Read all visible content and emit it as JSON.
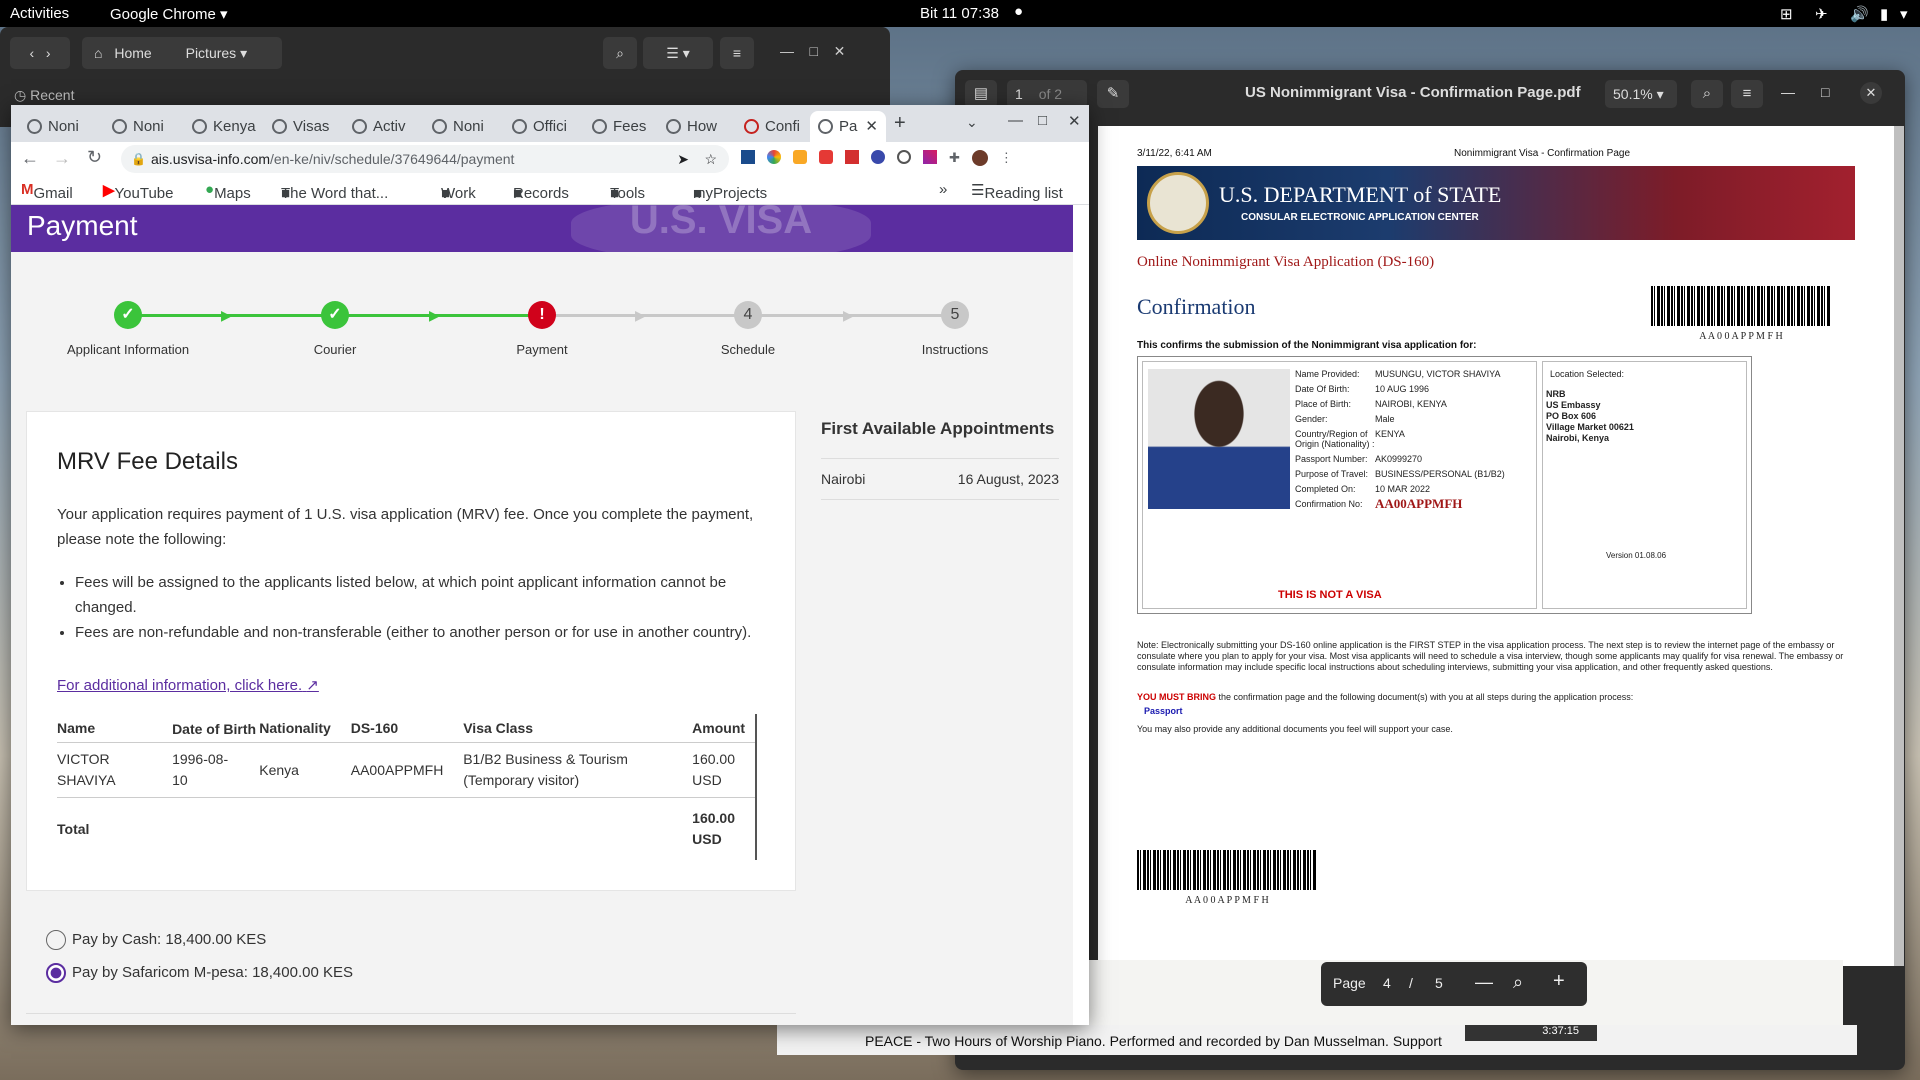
{
  "system_bar": {
    "activities": "Activities",
    "app": "Google Chrome",
    "clock": "Bit 11  07:38"
  },
  "file_manager": {
    "home": "Home",
    "pictures": "Pictures",
    "recent": "Recent"
  },
  "chrome": {
    "tabs": [
      "Noni",
      "Noni",
      "Kenya",
      "Visas",
      "Activ",
      "Noni",
      "Offici",
      "Fees",
      "How",
      "Confi",
      "Pa"
    ],
    "url_host": "ais.usvisa-info.com",
    "url_path": "/en-ke/niv/schedule/37649644/payment",
    "bookmarks": [
      "Gmail",
      "YouTube",
      "Maps",
      "The Word that...",
      "Work",
      "Records",
      "Tools",
      "myProjects"
    ],
    "reading_list": "Reading list"
  },
  "page": {
    "banner_title": "Payment",
    "steps": [
      {
        "label": "Applicant Information",
        "mark": "✓"
      },
      {
        "label": "Courier",
        "mark": "✓"
      },
      {
        "label": "Payment",
        "mark": "!"
      },
      {
        "label": "Schedule",
        "mark": "4"
      },
      {
        "label": "Instructions",
        "mark": "5"
      }
    ],
    "card": {
      "title": "MRV Fee Details",
      "intro": "Your application requires payment of 1 U.S. visa application (MRV) fee. Once you complete the payment, please note the following:",
      "bullet1": "Fees will be assigned to the applicants listed below, at which point applicant information cannot be changed.",
      "bullet2": "Fees are non-refundable and non-transferable (either to another person or for use in another country).",
      "link": "For additional information, click here.",
      "headers": {
        "name": "Name",
        "dob": "Date of Birth",
        "nationality": "Nationality",
        "ds160": "DS-160",
        "visa_class": "Visa Class",
        "amount": "Amount"
      },
      "row": {
        "name": "VICTOR SHAVIYA",
        "dob": "1996-08-10",
        "nationality": "Kenya",
        "ds160": "AA00APPMFH",
        "visa_class": "B1/B2 Business & Tourism (Temporary visitor)",
        "amount": "160.00 USD"
      },
      "total_label": "Total",
      "total_amount": "160.00 USD"
    },
    "side": {
      "title": "First Available Appointments",
      "city": "Nairobi",
      "date": "16 August, 2023"
    },
    "payment_options": [
      "Pay by Cash: 18,400.00 KES",
      "Pay by Safaricom M-pesa: 18,400.00 KES"
    ]
  },
  "pdf_viewer": {
    "page_box": "1",
    "page_of": "of 2",
    "title": "US Nonimmigrant Visa - Confirmation Page.pdf",
    "zoom": "50.1%",
    "doc": {
      "timestamp": "3/11/22, 6:41 AM",
      "header_title": "Nonimmigrant Visa - Confirmation Page",
      "dept": "U.S. DEPARTMENT of STATE",
      "ceac": "CONSULAR ELECTRONIC APPLICATION CENTER",
      "app_title": "Online Nonimmigrant Visa Application (DS-160)",
      "confirmation": "Confirmation",
      "barcode_text": "A A 0 0 A P P M F H",
      "confirms": "This confirms the submission of the Nonimmigrant visa application for:",
      "fields": [
        {
          "k": "Name Provided:",
          "v": "MUSUNGU, VICTOR SHAVIYA"
        },
        {
          "k": "Date Of Birth:",
          "v": "10 AUG 1996"
        },
        {
          "k": "Place of Birth:",
          "v": "NAIROBI, KENYA"
        },
        {
          "k": "Gender:",
          "v": "Male"
        },
        {
          "k": "Country/Region of Origin (Nationality) :",
          "v": "KENYA"
        },
        {
          "k": "Passport Number:",
          "v": "AK0999270"
        },
        {
          "k": "Purpose of Travel:",
          "v": "BUSINESS/PERSONAL (B1/B2)"
        },
        {
          "k": "Completed On:",
          "v": "10 MAR 2022"
        },
        {
          "k": "Confirmation No:",
          "v": "AA00APPMFH"
        }
      ],
      "not_visa": "THIS IS NOT A VISA",
      "location_label": "Location Selected:",
      "location": [
        "NRB",
        "US Embassy",
        "PO Box 606",
        "Village Market 00621",
        "Nairobi, Kenya"
      ],
      "version": "Version 01.08.06",
      "note": "Note: Electronically submitting your DS-160 online application is the FIRST STEP in the visa application process. The next step is to review the internet page of the embassy or consulate where you plan to apply for your visa. Most visa applicants will need to schedule a visa interview, though some applicants may qualify for visa renewal. The embassy or consulate information may include specific local instructions about scheduling interviews, submitting your visa application, and other frequently asked questions.",
      "must_bring_label": "YOU MUST BRING",
      "must_bring": " the confirmation page and the following document(s) with you at all steps during the application process:",
      "passport": "Passport",
      "additional": "You may also provide any additional documents you feel will support your case."
    },
    "page_label": "Page",
    "page_num": "4",
    "page_sep": "/",
    "page_total": "5"
  },
  "taskbar_text": "PEACE - Two Hours of Worship Piano. Performed and recorded by Dan Musselman. Support",
  "video_time": "3:37:15",
  "colors": {
    "purple": "#5b2da0",
    "green": "#3bc43b",
    "red": "#d0021b",
    "grey": "#c8c8c8"
  }
}
